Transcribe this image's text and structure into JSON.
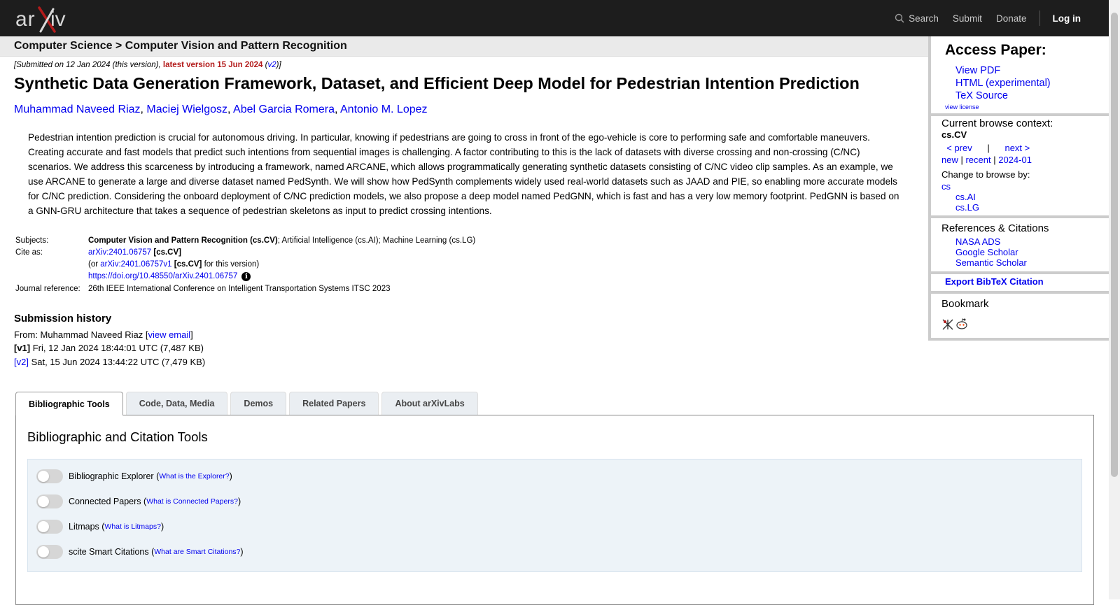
{
  "header": {
    "logo_text": "arXiv",
    "nav": {
      "search": "Search",
      "submit": "Submit",
      "donate": "Donate",
      "login": "Log in"
    }
  },
  "breadcrumb": "Computer Science > Computer Vision and Pattern Recognition",
  "dateline": {
    "submitted": "[Submitted on 12 Jan 2024 (this version), ",
    "latest": "latest version 15 Jun 2024",
    "open": " (",
    "v2": "v2",
    "close": ")]"
  },
  "paper": {
    "title": "Synthetic Data Generation Framework, Dataset, and Efficient Deep Model for Pedestrian Intention Prediction",
    "authors": [
      "Muhammad Naveed Riaz",
      "Maciej Wielgosz",
      "Abel Garcia Romera",
      "Antonio M. Lopez"
    ],
    "abstract": "Pedestrian intention prediction is crucial for autonomous driving. In particular, knowing if pedestrians are going to cross in front of the ego-vehicle is core to performing safe and comfortable maneuvers. Creating accurate and fast models that predict such intentions from sequential images is challenging. A factor contributing to this is the lack of datasets with diverse crossing and non-crossing (C/NC) scenarios. We address this scarceness by introducing a framework, named ARCANE, which allows programmatically generating synthetic datasets consisting of C/NC video clip samples. As an example, we use ARCANE to generate a large and diverse dataset named PedSynth. We will show how PedSynth complements widely used real-world datasets such as JAAD and PIE, so enabling more accurate models for C/NC prediction. Considering the onboard deployment of C/NC prediction models, we also propose a deep model named PedGNN, which is fast and has a very low memory footprint. PedGNN is based on a GNN-GRU architecture that takes a sequence of pedestrian skeletons as input to predict crossing intentions."
  },
  "metadata": {
    "subjects_label": "Subjects:",
    "subjects_primary": "Computer Vision and Pattern Recognition (cs.CV)",
    "subjects_rest": "; Artificial Intelligence (cs.AI); Machine Learning (cs.LG)",
    "cite_label": "Cite as:",
    "cite_id": "arXiv:2401.06757",
    "cite_cat": "[cs.CV]",
    "cite_v_open": "(or ",
    "cite_v_id": "arXiv:2401.06757v1",
    "cite_v_cat": "[cs.CV]",
    "cite_v_close": " for this version)",
    "doi": "https://doi.org/10.48550/arXiv.2401.06757",
    "journal_label": "Journal reference:",
    "journal": "26th IEEE International Conference on Intelligent Transportation Systems ITSC 2023"
  },
  "submission_history": {
    "heading": "Submission history",
    "from_prefix": "From: Muhammad Naveed Riaz [",
    "view_email": "view email",
    "from_suffix": "]",
    "v1_tag": "[v1]",
    "v1_text": " Fri, 12 Jan 2024 18:44:01 UTC (7,487 KB)",
    "v2_tag": "[v2]",
    "v2_text": " Sat, 15 Jun 2024 13:44:22 UTC (7,479 KB)"
  },
  "sidebar": {
    "access_heading": "Access Paper:",
    "access_links": [
      "View PDF",
      "HTML (experimental)",
      "TeX Source"
    ],
    "view_license": "view license",
    "context_heading": "Current browse context:",
    "context_value": "cs.CV",
    "prev": "< prev",
    "pipe": "|",
    "next": "next >",
    "new": "new",
    "recent": "recent",
    "month": "2024-01",
    "change_browse": "Change to browse by:",
    "browse_cs": "cs",
    "browse_ai": "cs.AI",
    "browse_lg": "cs.LG",
    "refs_heading": "References & Citations",
    "refs": [
      "NASA ADS",
      "Google Scholar",
      "Semantic Scholar"
    ],
    "export_bibtex": "Export BibTeX Citation",
    "bookmark_heading": "Bookmark"
  },
  "tabs": [
    "Bibliographic Tools",
    "Code, Data, Media",
    "Demos",
    "Related Papers",
    "About arXivLabs"
  ],
  "tools_panel": {
    "heading": "Bibliographic and Citation Tools",
    "tools": [
      {
        "name": "Bibliographic Explorer",
        "help": "What is the Explorer?"
      },
      {
        "name": "Connected Papers",
        "help": "What is Connected Papers?"
      },
      {
        "name": "Litmaps",
        "help": "What is Litmaps?"
      },
      {
        "name": "scite Smart Citations",
        "help": "What are Smart Citations?"
      }
    ]
  },
  "colors": {
    "header_bg": "#1d1d1d",
    "arxiv_red": "#b31b1b",
    "link": "#0000ee"
  }
}
